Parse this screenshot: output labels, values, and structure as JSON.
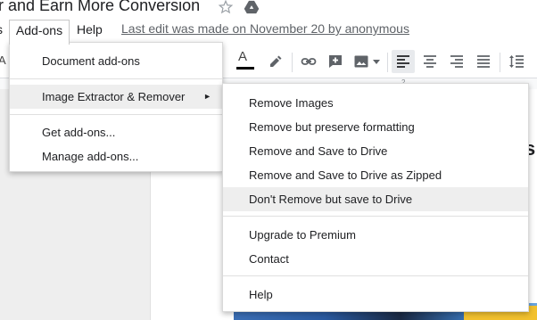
{
  "document": {
    "title": "r and Earn More Conversion",
    "last_edit": "Last edit was made on November 20 by anonymous",
    "heading_fragment": "s",
    "ruler_mark": "2"
  },
  "menubar": {
    "cut_item": "s",
    "addons": "Add-ons",
    "help": "Help"
  },
  "toolbar": {
    "cut_item": "A",
    "text_color_glyph": "A",
    "text_color_underline": "#000000"
  },
  "addons_menu": {
    "items": [
      {
        "label": "Document add-ons"
      },
      {
        "label": "Image Extractor & Remover",
        "arrow": "►"
      },
      {
        "label": "Get add-ons..."
      },
      {
        "label": "Manage add-ons..."
      }
    ]
  },
  "submenu": {
    "items": [
      {
        "label": "Remove Images"
      },
      {
        "label": "Remove but preserve formatting"
      },
      {
        "label": "Remove and Save to Drive"
      },
      {
        "label": "Remove and Save to Drive as Zipped"
      },
      {
        "label": "Don't Remove but save to Drive"
      },
      {
        "label": "Upgrade to Premium"
      },
      {
        "label": "Contact"
      },
      {
        "label": "Help"
      }
    ]
  },
  "colors": {
    "highlight": "#eeeeee",
    "accent_active": "#e8eaed"
  }
}
